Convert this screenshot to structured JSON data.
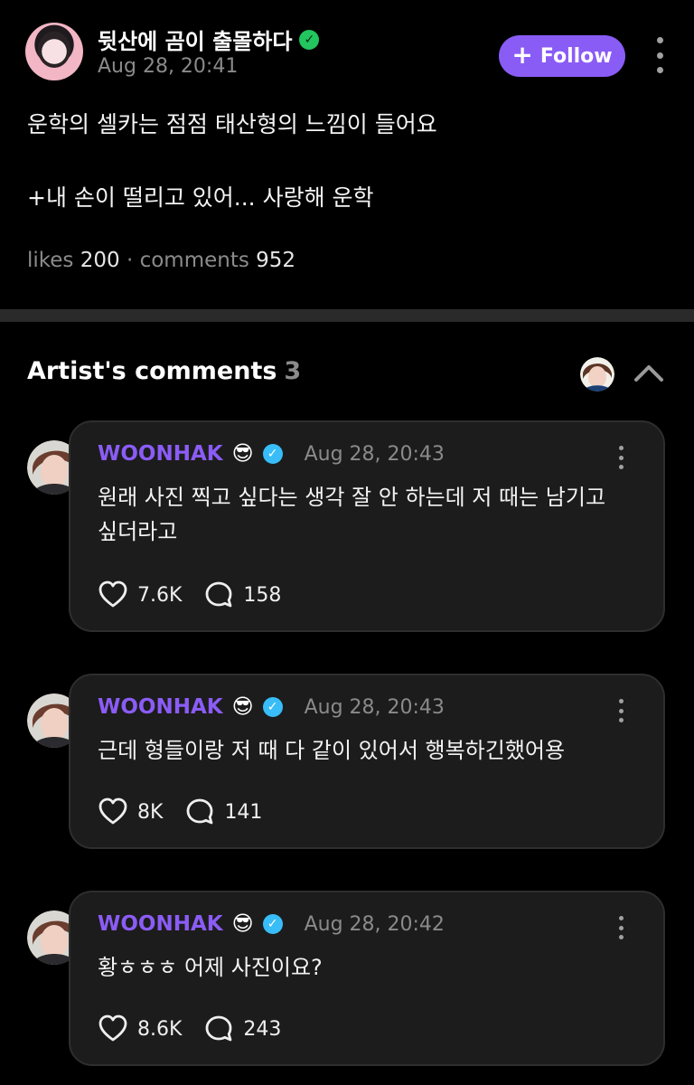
{
  "post": {
    "author": "뒷산에 곰이 출몰하다",
    "time": "Aug 28, 20:41",
    "follow_label": "Follow",
    "body_lines": [
      "운학의 셀카는 점점 태산형의 느낌이 들어요",
      "+내 손이 떨리고 있어... 사랑해 운학"
    ],
    "likes_label": "likes",
    "likes": "200",
    "comments_label": "comments",
    "comments": "952"
  },
  "artist_comments": {
    "title": "Artist's comments",
    "count": "3",
    "items": [
      {
        "name": "WOONHAK",
        "emoji": "😎",
        "time": "Aug 28, 20:43",
        "text": "원래 사진 찍고 싶다는 생각 잘 안 하는데 저 때는 남기고 싶더라고",
        "likes": "7.6K",
        "replies": "158"
      },
      {
        "name": "WOONHAK",
        "emoji": "😎",
        "time": "Aug 28, 20:43",
        "text": "근데 형들이랑 저 때 다 같이 있어서 행복하긴했어용",
        "likes": "8K",
        "replies": "141"
      },
      {
        "name": "WOONHAK",
        "emoji": "😎",
        "time": "Aug 28, 20:42",
        "text": "황ㅎㅎㅎ 어제 사진이요?",
        "likes": "8.6K",
        "replies": "243"
      }
    ]
  },
  "colors": {
    "accent": "#8b5cf6",
    "follow_bg": "#8a5cf6",
    "verified_author": "#22c55e",
    "verified_artist": "#38bdf8"
  },
  "icons": {
    "more": "more-vertical-icon",
    "heart": "heart-icon",
    "reply": "reply-bubble-icon",
    "collapse": "chevron-up-icon"
  }
}
